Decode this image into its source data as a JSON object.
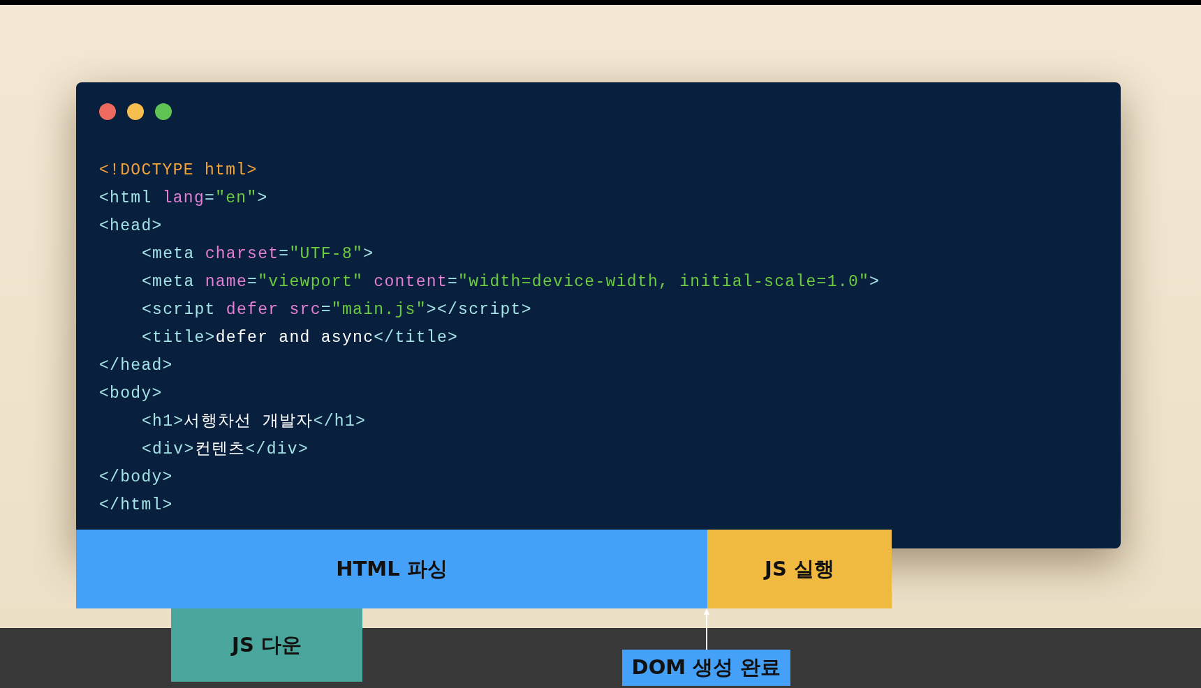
{
  "window_controls": [
    {
      "color": "#ee6a5e"
    },
    {
      "color": "#f6bd4f"
    },
    {
      "color": "#5fc454"
    }
  ],
  "code_lines": [
    {
      "tokens": [
        {
          "kind": "doctype",
          "text": "<!DOCTYPE html>"
        }
      ]
    },
    {
      "tokens": [
        {
          "kind": "tag",
          "text": "<html "
        },
        {
          "kind": "attr",
          "text": "lang"
        },
        {
          "kind": "tag",
          "text": "="
        },
        {
          "kind": "string",
          "text": "\"en\""
        },
        {
          "kind": "tag",
          "text": ">"
        }
      ]
    },
    {
      "tokens": [
        {
          "kind": "tag",
          "text": "<head>"
        }
      ],
      "children": [
        {
          "tokens": [
            {
              "kind": "tag",
              "text": "<meta "
            },
            {
              "kind": "attr",
              "text": "charset"
            },
            {
              "kind": "tag",
              "text": "="
            },
            {
              "kind": "string",
              "text": "\"UTF-8\""
            },
            {
              "kind": "tag",
              "text": ">"
            }
          ]
        },
        {
          "tokens": [
            {
              "kind": "tag",
              "text": "<meta "
            },
            {
              "kind": "attr",
              "text": "name"
            },
            {
              "kind": "tag",
              "text": "="
            },
            {
              "kind": "string",
              "text": "\"viewport\" "
            },
            {
              "kind": "attr",
              "text": "content"
            },
            {
              "kind": "tag",
              "text": "="
            },
            {
              "kind": "string",
              "text": "\"width=device-width, initial-scale=1.0\""
            },
            {
              "kind": "tag",
              "text": ">"
            }
          ]
        },
        {
          "tokens": [
            {
              "kind": "tag",
              "text": "<script "
            },
            {
              "kind": "attr",
              "text": "defer src"
            },
            {
              "kind": "tag",
              "text": "="
            },
            {
              "kind": "string",
              "text": "\"main.js\""
            },
            {
              "kind": "tag",
              "text": "></script>"
            }
          ]
        },
        {
          "tokens": [
            {
              "kind": "tag",
              "text": "<title>"
            },
            {
              "kind": "text",
              "text": "defer and async"
            },
            {
              "kind": "tag",
              "text": "</title>"
            }
          ]
        }
      ]
    },
    {
      "tokens": [
        {
          "kind": "tag",
          "text": "</head>"
        }
      ]
    },
    {
      "tokens": [
        {
          "kind": "tag",
          "text": "<body>"
        }
      ],
      "children": [
        {
          "tokens": [
            {
              "kind": "tag",
              "text": "<h1>"
            },
            {
              "kind": "text",
              "text": "서행차선 개발자"
            },
            {
              "kind": "tag",
              "text": "</h1>"
            }
          ]
        },
        {
          "tokens": [
            {
              "kind": "tag",
              "text": "<div>"
            },
            {
              "kind": "text",
              "text": "컨텐츠"
            },
            {
              "kind": "tag",
              "text": "</div>"
            }
          ]
        }
      ]
    },
    {
      "tokens": [
        {
          "kind": "tag",
          "text": "</body>"
        }
      ]
    },
    {
      "tokens": [
        {
          "kind": "tag",
          "text": "</html>"
        }
      ]
    }
  ],
  "timeline": {
    "top_row": [
      {
        "label": "HTML 파싱",
        "color": "#45a1f8"
      },
      {
        "label": "JS 실행",
        "color": "#f0ba40"
      }
    ],
    "bottom_row": [
      {
        "label": "JS 다운",
        "color": "#4aa69c"
      }
    ]
  },
  "marker": {
    "label": "DOM 생성 완료"
  }
}
